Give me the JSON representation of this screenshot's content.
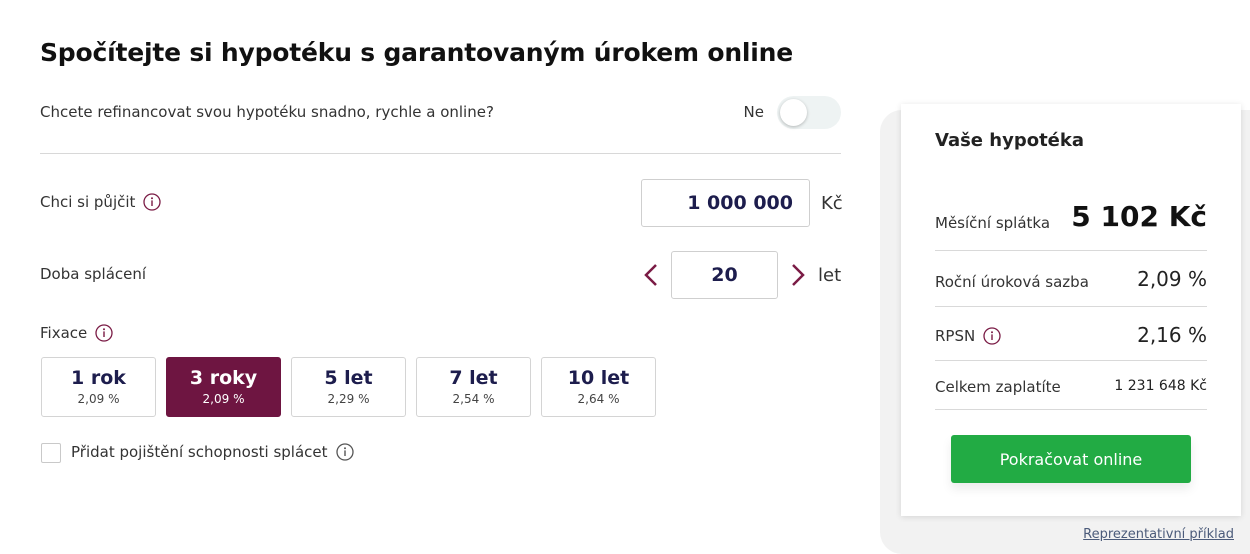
{
  "page_title": "Spočítejte si hypotéku s garantovaným úrokem online",
  "refinance": {
    "question": "Chcete refinancovat svou hypotéku snadno, rychle a online?",
    "toggle_state_label": "Ne"
  },
  "loan": {
    "label": "Chci si půjčit",
    "amount": "1 000 000",
    "currency": "Kč"
  },
  "term": {
    "label": "Doba splácení",
    "years": "20",
    "unit": "let"
  },
  "fixation": {
    "label": "Fixace",
    "options": [
      {
        "title": "1 rok",
        "rate": "2,09 %"
      },
      {
        "title": "3 roky",
        "rate": "2,09 %"
      },
      {
        "title": "5 let",
        "rate": "2,29 %"
      },
      {
        "title": "7 let",
        "rate": "2,54 %"
      },
      {
        "title": "10 let",
        "rate": "2,64 %"
      }
    ],
    "selected": "3 roky"
  },
  "insurance": {
    "label": "Přidat pojištění schopnosti splácet"
  },
  "summary": {
    "title": "Vaše hypotéka",
    "monthly_label": "Měsíční splátka",
    "monthly_value": "5 102 Kč",
    "rate_label": "Roční úroková sazba",
    "rate_value": "2,09 %",
    "rpsn_label": "RPSN",
    "rpsn_value": "2,16 %",
    "total_label": "Celkem zaplatíte",
    "total_value": "1 231 648 Kč",
    "cta_label": "Pokračovat online"
  },
  "representative_link": "Reprezentativní příklad",
  "colors": {
    "accent": "#6e1541",
    "cta": "#22ab44",
    "value_text": "#1d1d4d"
  }
}
